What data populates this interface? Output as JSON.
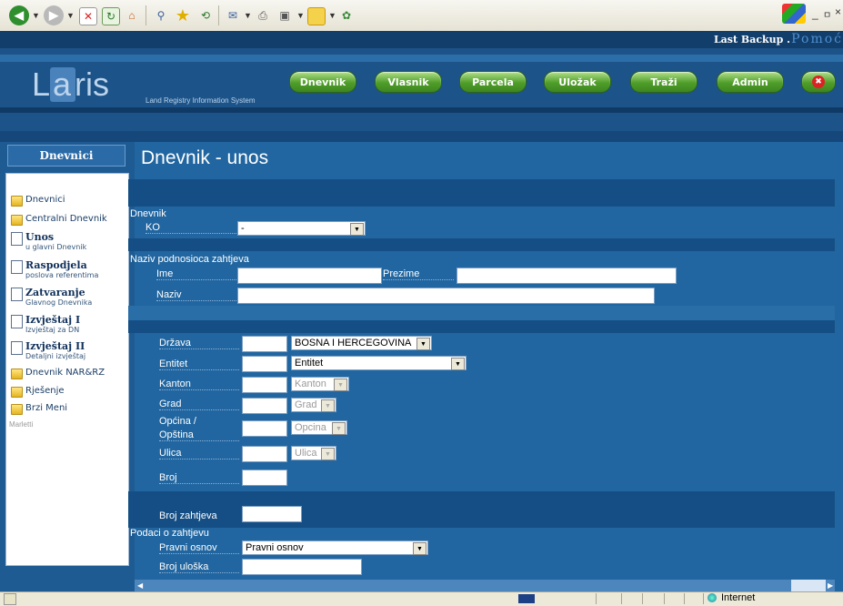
{
  "browser": {
    "toolbar_icons": [
      "back-icon",
      "forward-icon",
      "stop-icon",
      "refresh-icon",
      "home-icon",
      "search-icon",
      "favorites-icon",
      "history-icon",
      "mail-icon",
      "print-icon",
      "edit-icon",
      "folder-icon",
      "messenger-icon"
    ]
  },
  "header": {
    "backup_label": "Last Backup .",
    "help_label": "Pomoć",
    "logo_l": "L",
    "logo_a": "a",
    "logo_ris": "ris",
    "tagline": "Land Registry Information System",
    "nav": [
      "Dnevnik",
      "Vlasnik",
      "Parcela",
      "Uložak",
      "Traži",
      "Admin"
    ],
    "close_symbol": "✖"
  },
  "sidebar": {
    "title": "Dnevnici",
    "items": [
      {
        "label": "Dnevnici",
        "icon": "folder-icon"
      },
      {
        "label": "Centralni Dnevnik",
        "icon": "folder-icon"
      },
      {
        "label": "Unos",
        "sub": "u glavni Dnevnik",
        "icon": "document-icon"
      },
      {
        "label": "Raspodjela",
        "sub": "poslova referentima",
        "icon": "document-icon"
      },
      {
        "label": "Zatvaranje",
        "sub": "Glavnog Dnevnika",
        "icon": "document-icon"
      },
      {
        "label": "Izvještaj I",
        "sub": "Izvještaj za DN",
        "icon": "document-icon"
      },
      {
        "label": "Izvještaj II",
        "sub": "Detaljni izvještaj",
        "icon": "document-icon"
      },
      {
        "label": "Dnevnik NAR&RZ",
        "icon": "folder-icon"
      },
      {
        "label": "Rješenje",
        "icon": "folder-icon"
      },
      {
        "label": "Brzi Meni",
        "icon": "folder-icon"
      }
    ],
    "footer": "Marletti"
  },
  "main": {
    "title": "Dnevnik - unos",
    "section_dnevnik": "Dnevnik",
    "ko_label": "KO",
    "ko_value": "-",
    "section_podnosilac": "Naziv podnosioca zahtjeva",
    "ime_label": "Ime",
    "prezime_label": "Prezime",
    "naziv_label": "Naziv",
    "drzava_label": "Država",
    "drzava_value": "BOSNA I HERCEGOVINA",
    "entitet_label": "Entitet",
    "entitet_value": "Entitet",
    "kanton_label": "Kanton",
    "kanton_value": "Kanton",
    "grad_label": "Grad",
    "grad_value": "Grad",
    "opcina_label_1": "Općina /",
    "opcina_label_2": "Opština",
    "opcina_value": "Opcina",
    "ulica_label": "Ulica",
    "ulica_value": "Ulica",
    "broj_label": "Broj",
    "broj_zahtjeva_label": "Broj zahtjeva",
    "section_podaci": "Podaci o zahtjevu",
    "pravni_osnov_label": "Pravni osnov",
    "pravni_osnov_value": "Pravni osnov",
    "broj_uloska_label": "Broj uloška"
  },
  "statusbar": {
    "zone": "Internet"
  },
  "colors": {
    "header": "#1c5388",
    "main": "#2166a0",
    "band": "#154e84",
    "nav_green": "#4f9e2a"
  }
}
